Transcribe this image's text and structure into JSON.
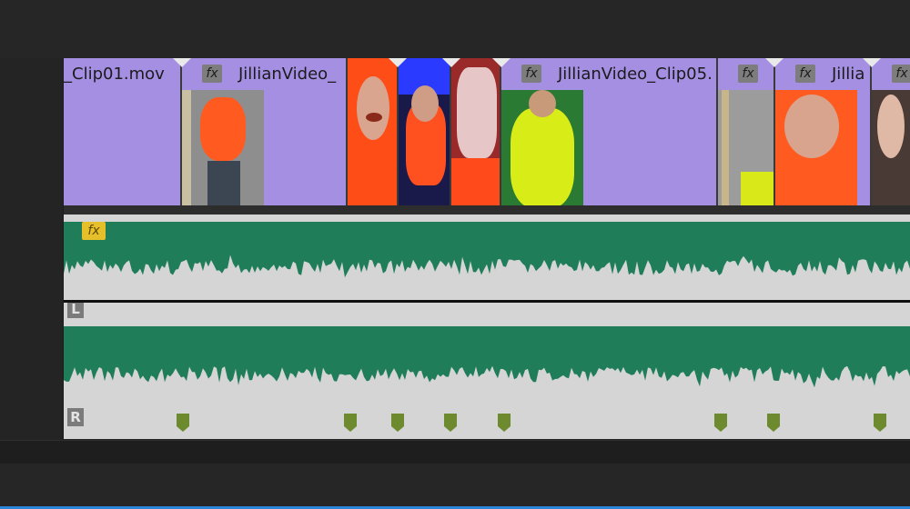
{
  "timeline": {
    "video_clips": [
      {
        "title": "_Clip01.mov",
        "fx": ""
      },
      {
        "title": "JillianVideo_",
        "fx": "fx"
      },
      {
        "title": "",
        "fx": ""
      },
      {
        "title": "",
        "fx": ""
      },
      {
        "title": "",
        "fx": ""
      },
      {
        "title": "JillianVideo_Clip05.",
        "fx": "fx"
      },
      {
        "title": "",
        "fx": "fx"
      },
      {
        "title": "Jillia",
        "fx": "fx"
      },
      {
        "title": "",
        "fx": "fx"
      }
    ],
    "audio": {
      "fx_badge": "fx",
      "left_channel_label": "L",
      "right_channel_label": "R",
      "waveform_color": "#1f7d5a",
      "track_bg_color": "#d5d5d5"
    },
    "colors": {
      "clip_purple": "#a48fe3",
      "gain_marker_green": "#6d8a2e",
      "playhead_accent": "#2c86d8"
    },
    "icons": [
      "fx-badge-icon",
      "edit-point-marker-icon",
      "gain-keyframe-icon"
    ]
  }
}
